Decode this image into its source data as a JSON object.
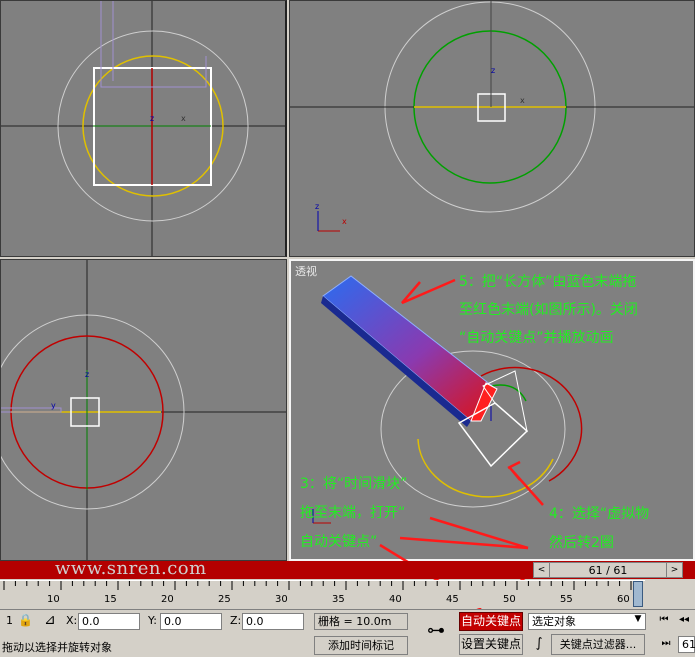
{
  "viewports": {
    "perspective_label": "透视"
  },
  "annotations": {
    "step5": [
      "5：把“长方体”由蓝色末端拖",
      "至红色末端(如图所示)。关闭",
      "“自动关键点”并播放动画"
    ],
    "step3": [
      "3：将“时间滑块”",
      "拖至末端，打开“",
      "自动关键点”"
    ],
    "step4": [
      "4：选择“虚拟物",
      "然后转2圈"
    ]
  },
  "watermark": "www.snren.com",
  "timeslider": {
    "label": "61 / 61",
    "prev_icon": "<",
    "next_icon": ">"
  },
  "ruler": {
    "ticks": [
      "10",
      "15",
      "20",
      "25",
      "30",
      "35",
      "40",
      "45",
      "50",
      "55",
      "60"
    ]
  },
  "statusbar": {
    "index": "1",
    "x_label": "X:",
    "x_value": "0.0",
    "y_label": "Y:",
    "y_value": "0.0",
    "z_label": "Z:",
    "z_value": "0.0",
    "grid": "栅格 = 10.0m",
    "auto_key": "自动关键点",
    "selection": "选定对象",
    "set_key": "设置关键点",
    "key_filters": "关键点过滤器...",
    "frame": "61",
    "prompt": "拖动以选择并旋转对象",
    "add_time_tag": "添加时间标记"
  },
  "colors": {
    "viewport_bg": "#808080",
    "auto_key_active": "#c20000",
    "annotation_text": "#22ee22",
    "track_bar": "#b40000"
  }
}
